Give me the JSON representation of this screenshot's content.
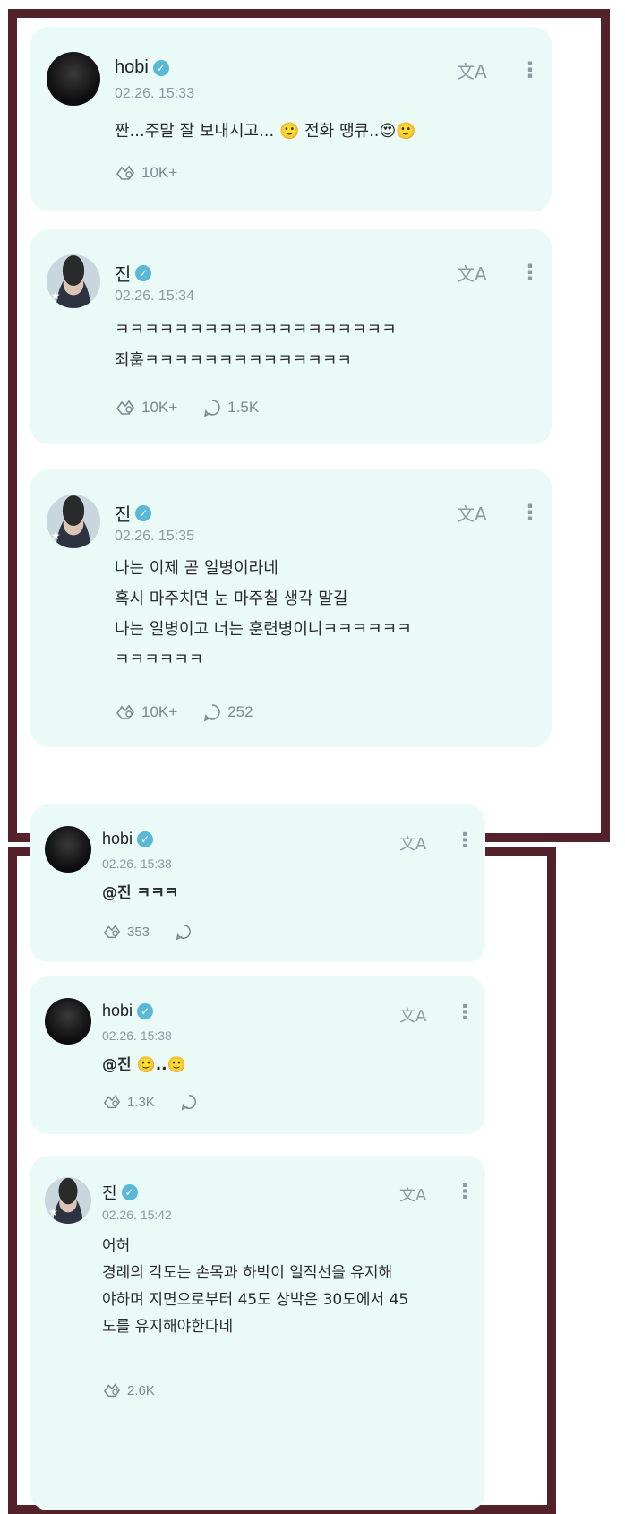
{
  "posts": [
    {
      "author": "hobi",
      "date": "02.26. 15:33",
      "text": "짠...주말 잘 보내시고... 🙂 전화 땡큐..😍🙂",
      "likes": "10K+",
      "comments": ""
    },
    {
      "author": "진",
      "date": "02.26. 15:34",
      "text": "ㅋㅋㅋㅋㅋㅋㅋㅋㅋㅋㅋㅋㅋㅋㅋㅋㅋㅋㅋ\n죄훕ㅋㅋㅋㅋㅋㅋㅋㅋㅋㅋㅋㅋㅋㅋ",
      "likes": "10K+",
      "comments": "1.5K"
    },
    {
      "author": "진",
      "date": "02.26. 15:35",
      "text": "나는 이제 곧 일병이라네\n혹시 마주치면 눈 마주칠 생각 말길\n나는 일병이고 너는 훈련병이니ㅋㅋㅋㅋㅋㅋ\nㅋㅋㅋㅋㅋㅋ",
      "likes": "10K+",
      "comments": "252"
    },
    {
      "author": "hobi",
      "date": "02.26. 15:38",
      "text": "@진 ㅋㅋㅋ",
      "likes": "353",
      "comments": ""
    },
    {
      "author": "hobi",
      "date": "02.26. 15:38",
      "text": "@진 🙂..🙂",
      "likes": "1.3K",
      "comments": ""
    },
    {
      "author": "진",
      "date": "02.26. 15:42",
      "text": "어허\n경례의 각도는 손목과 하박이 일직선을 유지해\n야하며 지면으로부터 45도 상박은 30도에서 45\n도를 유지해야한다네",
      "likes": "2.6K",
      "comments": ""
    }
  ],
  "icons": {
    "translate": "translate-icon",
    "more": "more-vertical-icon",
    "reaction": "reaction-icon",
    "comment": "comment-icon",
    "verified": "verified-icon"
  },
  "colors": {
    "card_bg": "#e9faf7",
    "frame": "#53222b",
    "verified": "#5ab7d6",
    "meta": "#8a9a9e"
  }
}
